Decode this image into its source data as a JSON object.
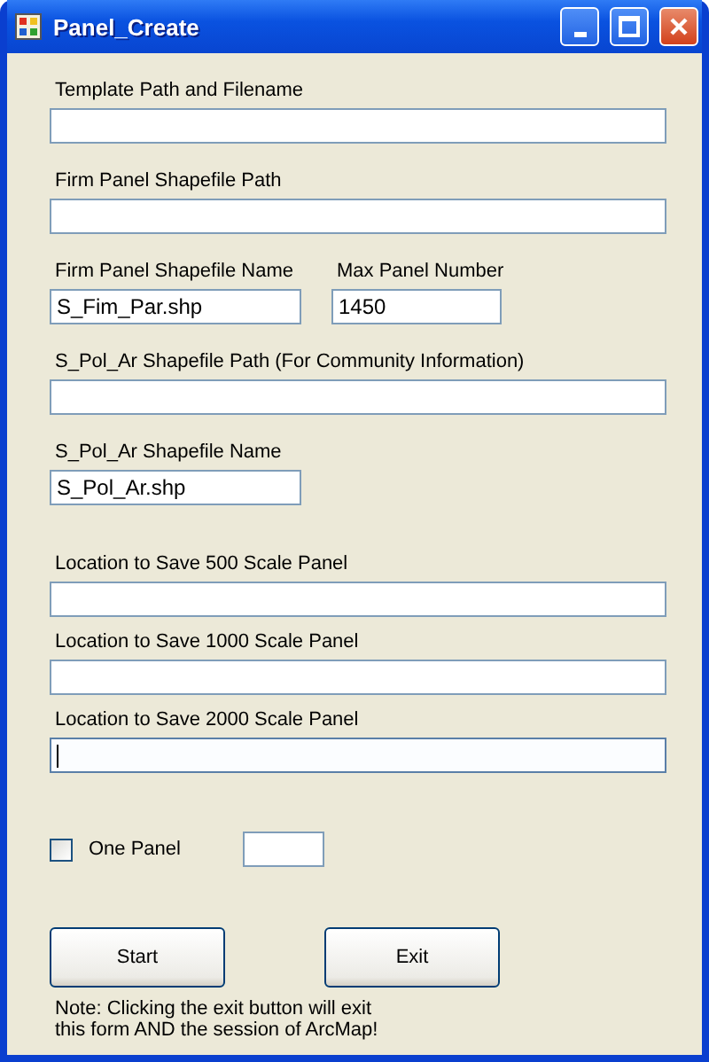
{
  "window": {
    "title": "Panel_Create"
  },
  "source_rows": [
    {
      "kind": "wide",
      "fields": [
        {
          "label": "Template Path and Filename"
        }
      ]
    },
    {
      "kind": "wide",
      "fields": [
        {
          "label": "Firm Panel Shapefile Path"
        }
      ]
    },
    {
      "kind": "pair",
      "fields": [
        {
          "label": "Firm Panel Shapefile Name",
          "value": "S_Fim_Par.shp"
        },
        {
          "label": "Max Panel Number",
          "value": "1450"
        }
      ]
    },
    {
      "kind": "wide",
      "fields": [
        {
          "label": "S_Pol_Ar Shapefile Path (For Community Information)"
        }
      ]
    },
    {
      "kind": "single",
      "fields": [
        {
          "label": "S_Pol_Ar Shapefile Name",
          "value": "S_Pol_Ar.shp"
        }
      ]
    }
  ],
  "output_fields": [
    {
      "label": "Location to Save 500 Scale Panel",
      "focused": false
    },
    {
      "label": "Location to Save 1000 Scale Panel",
      "focused": false
    },
    {
      "label": "Location to Save 2000 Scale Panel",
      "focused": true
    }
  ],
  "one_panel": {
    "label": "One Panel",
    "checked": false
  },
  "buttons": [
    "Start",
    "Exit"
  ],
  "note": "Note:  Clicking the exit button will exit this form AND the session of ArcMap!"
}
